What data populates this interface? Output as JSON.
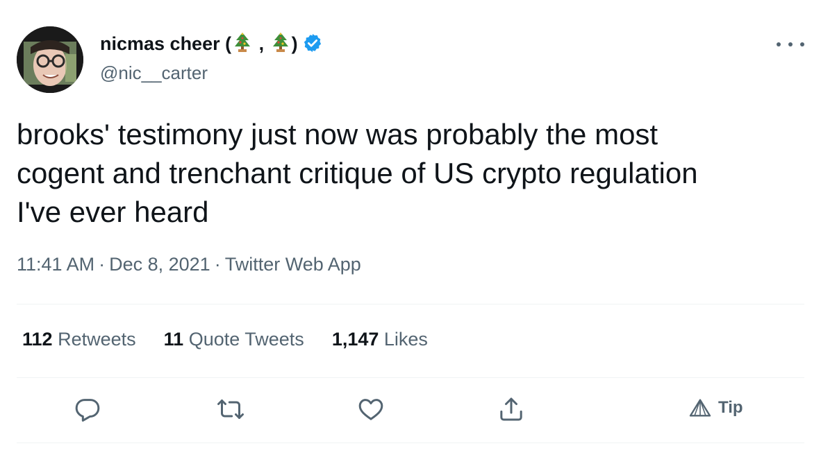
{
  "author": {
    "display_name": "nicmas cheer (",
    "display_name_mid": " , ",
    "display_name_end": ")",
    "handle": "@nic__carter",
    "verified": true
  },
  "tweet": {
    "text": "brooks' testimony just now was probably the most\ncogent and trenchant critique of US crypto regulation\nI've ever heard",
    "time": "11:41 AM",
    "date": "Dec 8, 2021",
    "source": "Twitter Web App",
    "separator": "·"
  },
  "stats": {
    "retweets": {
      "count": "112",
      "label": "Retweets"
    },
    "quote_tweets": {
      "count": "11",
      "label": "Quote Tweets"
    },
    "likes": {
      "count": "1,147",
      "label": "Likes"
    }
  },
  "actions": {
    "tip_label": "Tip"
  },
  "colors": {
    "text_primary": "#0f1419",
    "text_secondary": "#536471",
    "verified_blue": "#1d9bf0",
    "divider": "#eff3f4"
  },
  "icons": [
    "tree-emoji-icon",
    "verified-badge-icon",
    "more-icon",
    "reply-icon",
    "retweet-icon",
    "like-icon",
    "share-icon",
    "tip-icon"
  ]
}
